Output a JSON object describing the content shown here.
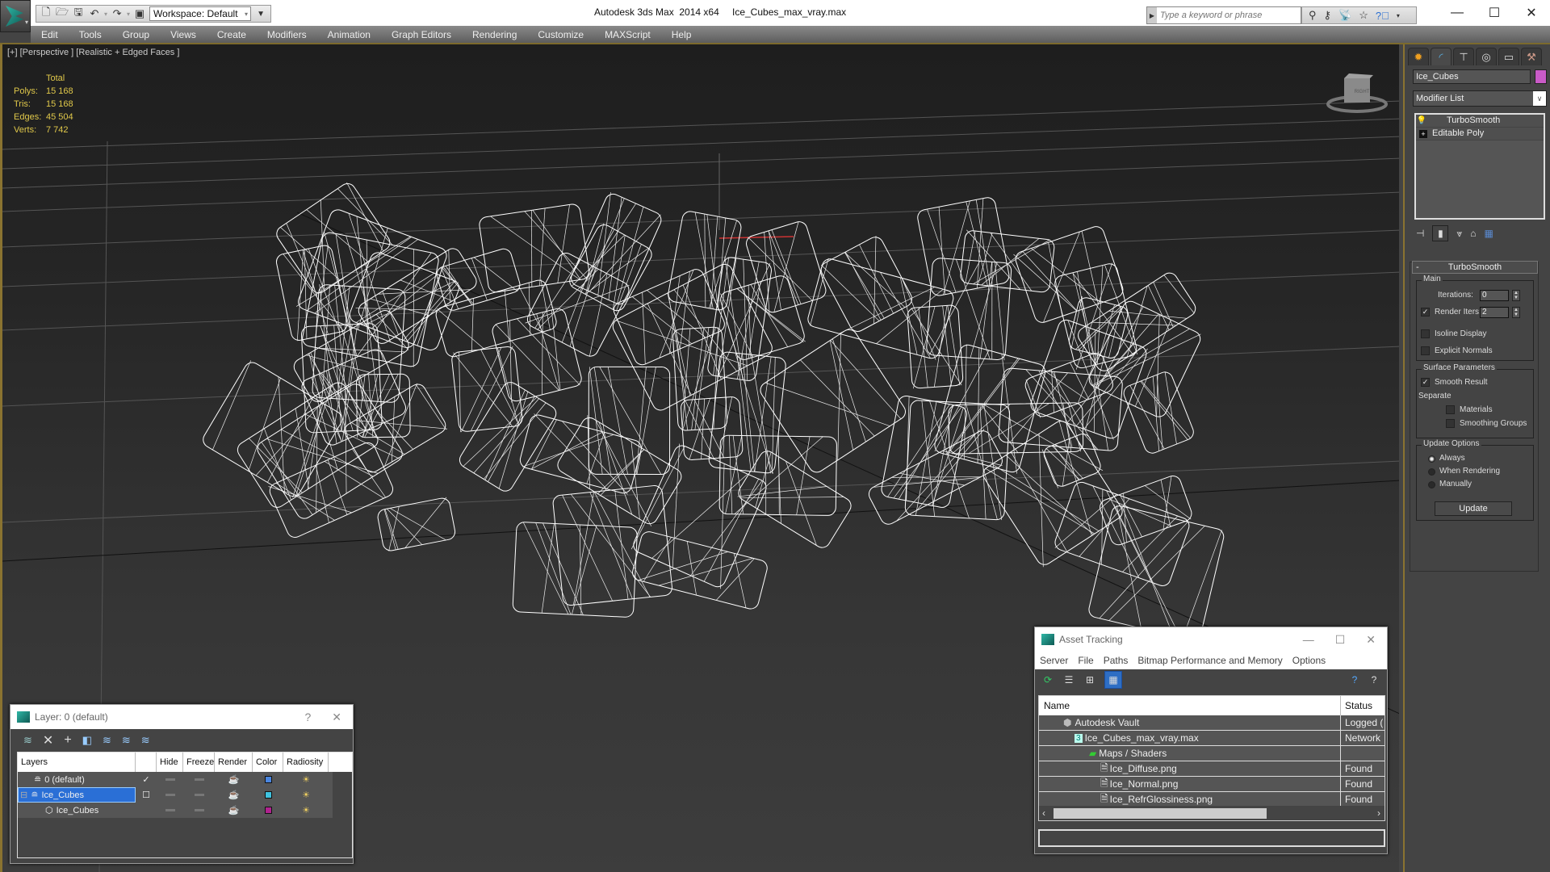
{
  "titlebar": {
    "app_title": "Autodesk 3ds Max  2014 x64",
    "file_name": "Ice_Cubes_max_vray.max",
    "workspace_label": "Workspace: Default",
    "search_placeholder": "Type a keyword or phrase",
    "icons": [
      "new-file-icon",
      "open-file-icon",
      "save-icon",
      "undo-icon",
      "redo-icon",
      "project-folder-icon"
    ],
    "info_icons": [
      "binoculars-icon",
      "key-icon",
      "satellite-icon",
      "star-icon",
      "help-icon"
    ]
  },
  "menubar": {
    "items": [
      "Edit",
      "Tools",
      "Group",
      "Views",
      "Create",
      "Modifiers",
      "Animation",
      "Graph Editors",
      "Rendering",
      "Customize",
      "MAXScript",
      "Help"
    ]
  },
  "viewport": {
    "label": "[+] [Perspective ] [Realistic + Edged Faces ]",
    "stats": {
      "header": "Total",
      "rows": [
        {
          "label": "Polys:",
          "value": "15 168"
        },
        {
          "label": "Tris:",
          "value": "15 168"
        },
        {
          "label": "Edges:",
          "value": "45 504"
        },
        {
          "label": "Verts:",
          "value": "7 742"
        }
      ]
    },
    "viewcube_label": "RIGHT",
    "stats_color": "#e0c84a"
  },
  "command_panel": {
    "tabs": [
      "create-icon",
      "modify-icon",
      "hierarchy-icon",
      "motion-icon",
      "display-icon",
      "utilities-icon"
    ],
    "object_name": "Ice_Cubes",
    "object_color": "#c95bc7",
    "modifier_list_label": "Modifier List",
    "stack": [
      {
        "label": "TurboSmooth",
        "icon": "lightbulb-icon"
      },
      {
        "label": "Editable Poly",
        "icon": "expand-icon"
      }
    ],
    "turbosmooth": {
      "title": "TurboSmooth",
      "main_label": "Main",
      "iterations_label": "Iterations:",
      "iterations_value": "0",
      "render_iters_label": "Render Iters:",
      "render_iters_value": "2",
      "render_iters_checked": true,
      "isoline_label": "Isoline Display",
      "isoline_checked": false,
      "explicit_normals_label": "Explicit Normals",
      "explicit_normals_checked": false,
      "surface_label": "Surface Parameters",
      "smooth_result_label": "Smooth Result",
      "smooth_result_checked": true,
      "separate_label": "Separate",
      "materials_label": "Materials",
      "smoothing_groups_label": "Smoothing Groups",
      "update_options_label": "Update Options",
      "always_label": "Always",
      "when_rendering_label": "When Rendering",
      "manually_label": "Manually",
      "update_selected": "Always",
      "update_button": "Update"
    }
  },
  "layer_dialog": {
    "title": "Layer: 0 (default)",
    "help": "?",
    "close": "✕",
    "columns": [
      "Layers",
      "",
      "Hide",
      "Freeze",
      "Render",
      "Color",
      "Radiosity"
    ],
    "rows": [
      {
        "name": "0 (default)",
        "current": "✓",
        "color": "#4a86e0",
        "selected": false,
        "indent": 1
      },
      {
        "name": "Ice_Cubes",
        "current": "☐",
        "color": "#3fc3e0",
        "selected": true,
        "indent": 0
      },
      {
        "name": "Ice_Cubes",
        "current": "",
        "color": "#b0228f",
        "selected": false,
        "indent": 2
      }
    ]
  },
  "asset_tracking": {
    "title": "Asset Tracking",
    "menu": [
      "Server",
      "File",
      "Paths",
      "Bitmap Performance and Memory",
      "Options"
    ],
    "columns": [
      "Name",
      "Status"
    ],
    "rows": [
      {
        "name": "Autodesk Vault",
        "status": "Logged (",
        "indent": 1,
        "icon": "vault-icon"
      },
      {
        "name": "Ice_Cubes_max_vray.max",
        "status": "Network",
        "indent": 2,
        "icon": "max-file-icon"
      },
      {
        "name": "Maps / Shaders",
        "status": "",
        "indent": 3,
        "icon": "maps-icon"
      },
      {
        "name": "Ice_Diffuse.png",
        "status": "Found",
        "indent": 4,
        "icon": "image-file-icon"
      },
      {
        "name": "Ice_Normal.png",
        "status": "Found",
        "indent": 4,
        "icon": "image-file-icon"
      },
      {
        "name": "Ice_RefrGlossiness.png",
        "status": "Found",
        "indent": 4,
        "icon": "image-file-icon"
      }
    ]
  }
}
